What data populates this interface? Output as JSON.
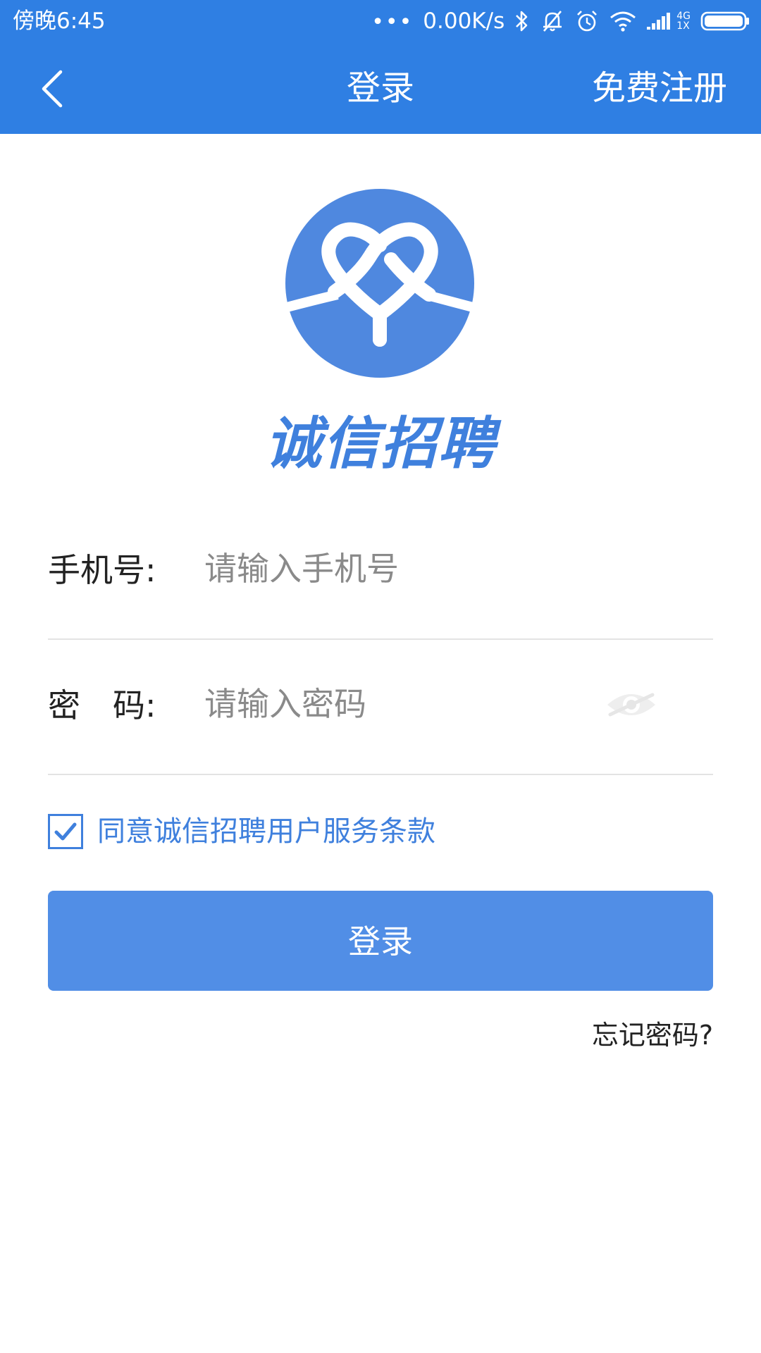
{
  "status_bar": {
    "time": "傍晚6:45",
    "dots": "•••",
    "speed": "0.00K/s",
    "network_top": "4G",
    "network_bottom": "1X",
    "icons": [
      "bluetooth-icon",
      "mute-bell-icon",
      "alarm-icon",
      "wifi-icon",
      "signal-icon",
      "battery-icon"
    ]
  },
  "navbar": {
    "back_icon": "chevron-left-icon",
    "title": "登录",
    "register": "免费注册"
  },
  "brand": {
    "name": "诚信招聘",
    "color": "#3f80dd"
  },
  "form": {
    "phone_label": "手机号:",
    "phone_placeholder": "请输入手机号",
    "phone_value": "",
    "password_label": "密　码:",
    "password_placeholder": "请输入密码",
    "password_value": "",
    "eye_icon": "eye-hidden-icon"
  },
  "agreement": {
    "checked": true,
    "text": "同意诚信招聘用户服务条款"
  },
  "login_button": "登录",
  "forgot_password": "忘记密码?",
  "colors": {
    "header": "#2f7fe3",
    "button": "#518ee6",
    "accent": "#3f80dd"
  }
}
